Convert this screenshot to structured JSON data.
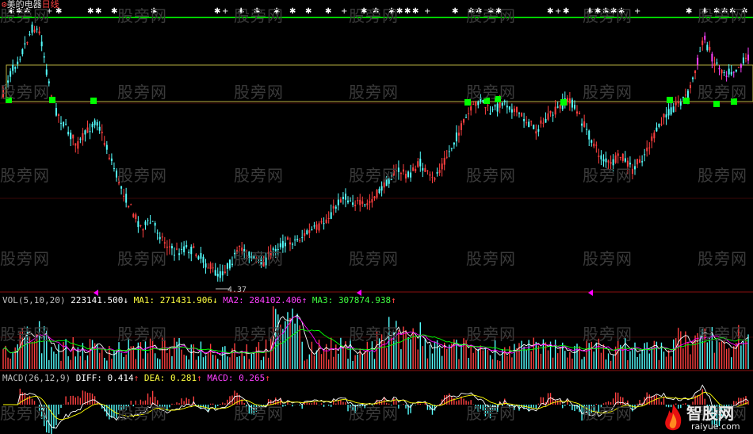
{
  "header": {
    "stock_name": "美的电器",
    "period": "日线",
    "low_price_marker": "4.37",
    "site_watermark": "股旁网",
    "logo_text": "智股网",
    "logo_url": "raiyue.com"
  },
  "vol_panel": {
    "title": "VOL(5,10,20)",
    "value": "223141.500",
    "value_arrow": "↓",
    "ma1_label": "MA1:",
    "ma1_value": "271431.906",
    "ma1_arrow": "↓",
    "ma2_label": "MA2:",
    "ma2_value": "284102.406",
    "ma2_arrow": "↑",
    "ma3_label": "MA3:",
    "ma3_value": "307874.938",
    "ma3_arrow": "↑"
  },
  "macd_panel": {
    "title": "MACD(26,12,9)",
    "diff_label": "DIFF:",
    "diff_value": "0.414",
    "diff_arrow": "↑",
    "dea_label": "DEA:",
    "dea_value": "0.281",
    "dea_arrow": "↑",
    "macd_label": "MACD:",
    "macd_value": "0.265",
    "macd_arrow": "↑"
  },
  "colors": {
    "up": "#ff4040",
    "down": "#54ffff",
    "resistance_line": "#00d000",
    "support_line": "#b8b040",
    "signal_square": "#00ff00",
    "vol_ma1": "#ffffff",
    "vol_ma2": "#ff00ff",
    "vol_ma3": "#00ff00",
    "macd_diff": "#ffffff",
    "macd_dea": "#ffff00",
    "tail_line": "#ff40ff"
  },
  "chart_data": {
    "type": "candlestick",
    "price_low_label": 4.37,
    "price_path": [
      [
        0,
        0.28
      ],
      [
        0.01,
        0.2
      ],
      [
        0.025,
        0.12
      ],
      [
        0.04,
        0.02
      ],
      [
        0.05,
        0.05
      ],
      [
        0.06,
        0.22
      ],
      [
        0.07,
        0.34
      ],
      [
        0.085,
        0.42
      ],
      [
        0.1,
        0.48
      ],
      [
        0.115,
        0.42
      ],
      [
        0.125,
        0.38
      ],
      [
        0.14,
        0.5
      ],
      [
        0.155,
        0.62
      ],
      [
        0.17,
        0.72
      ],
      [
        0.185,
        0.8
      ],
      [
        0.2,
        0.78
      ],
      [
        0.215,
        0.85
      ],
      [
        0.23,
        0.9
      ],
      [
        0.245,
        0.88
      ],
      [
        0.26,
        0.9
      ],
      [
        0.275,
        0.95
      ],
      [
        0.29,
        0.99
      ],
      [
        0.305,
        0.94
      ],
      [
        0.32,
        0.88
      ],
      [
        0.335,
        0.92
      ],
      [
        0.35,
        0.94
      ],
      [
        0.365,
        0.88
      ],
      [
        0.38,
        0.86
      ],
      [
        0.395,
        0.85
      ],
      [
        0.41,
        0.82
      ],
      [
        0.425,
        0.8
      ],
      [
        0.44,
        0.75
      ],
      [
        0.455,
        0.68
      ],
      [
        0.47,
        0.7
      ],
      [
        0.485,
        0.72
      ],
      [
        0.5,
        0.68
      ],
      [
        0.515,
        0.62
      ],
      [
        0.53,
        0.58
      ],
      [
        0.545,
        0.6
      ],
      [
        0.56,
        0.55
      ],
      [
        0.575,
        0.62
      ],
      [
        0.585,
        0.58
      ],
      [
        0.6,
        0.5
      ],
      [
        0.61,
        0.44
      ],
      [
        0.625,
        0.36
      ],
      [
        0.64,
        0.3
      ],
      [
        0.655,
        0.36
      ],
      [
        0.67,
        0.31
      ],
      [
        0.685,
        0.34
      ],
      [
        0.7,
        0.38
      ],
      [
        0.715,
        0.42
      ],
      [
        0.73,
        0.38
      ],
      [
        0.745,
        0.34
      ],
      [
        0.76,
        0.3
      ],
      [
        0.775,
        0.38
      ],
      [
        0.79,
        0.46
      ],
      [
        0.8,
        0.52
      ],
      [
        0.815,
        0.56
      ],
      [
        0.83,
        0.52
      ],
      [
        0.845,
        0.58
      ],
      [
        0.86,
        0.52
      ],
      [
        0.875,
        0.44
      ],
      [
        0.89,
        0.36
      ],
      [
        0.905,
        0.32
      ],
      [
        0.92,
        0.28
      ],
      [
        0.93,
        0.18
      ],
      [
        0.94,
        0.06
      ],
      [
        0.955,
        0.16
      ],
      [
        0.97,
        0.2
      ],
      [
        0.985,
        0.18
      ],
      [
        1,
        0.14
      ]
    ],
    "resistance_level": "top green line",
    "signal_points": 12,
    "series": [
      {
        "name": "VOL",
        "type": "bar"
      },
      {
        "name": "MA1",
        "type": "line"
      },
      {
        "name": "MA2",
        "type": "line"
      },
      {
        "name": "MA3",
        "type": "line"
      },
      {
        "name": "DIFF",
        "type": "line"
      },
      {
        "name": "DEA",
        "type": "line"
      },
      {
        "name": "MACD",
        "type": "bar"
      }
    ]
  }
}
